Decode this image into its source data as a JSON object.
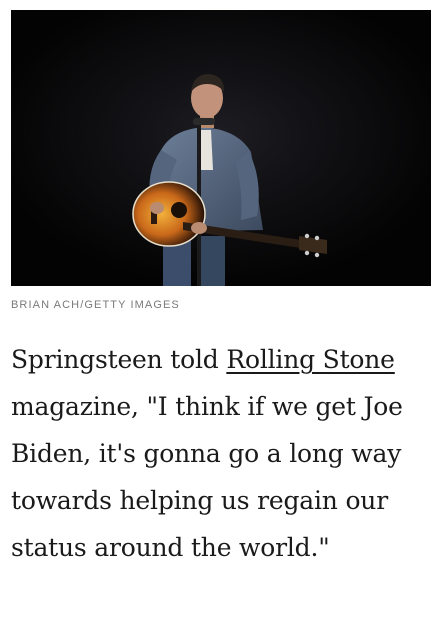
{
  "photo": {
    "subject": "man-with-guitar"
  },
  "credit": "BRIAN ACH/GETTY IMAGES",
  "article": {
    "text_before_link": "Springsteen told ",
    "link_text": "Rolling Stone",
    "text_after_link": " magazine, \"I think if we get Joe Biden, it's gonna go a long way towards helping us regain our status around the world.\""
  }
}
